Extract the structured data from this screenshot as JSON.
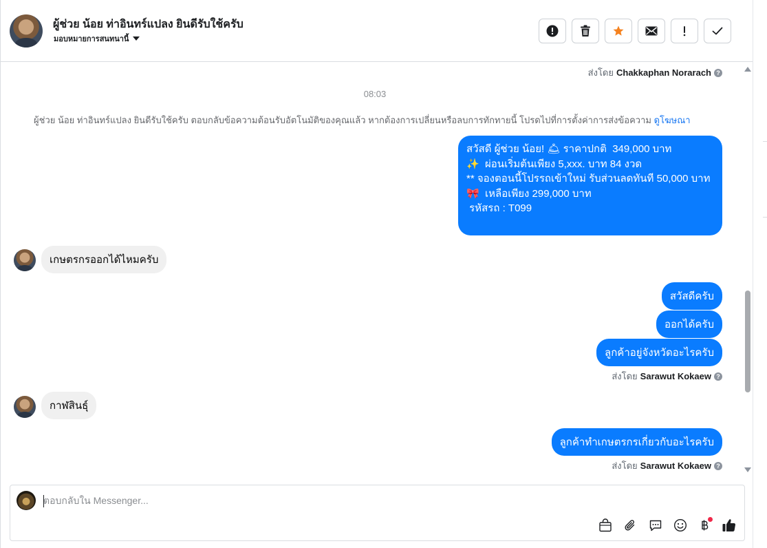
{
  "header": {
    "title": "ผู้ช่วย น้อย ท่าอินทร์แปลง ยินดีรับใช้ครับ",
    "subtitle": "มอบหมายการสนทนานี้",
    "actions": [
      "report-icon",
      "trash-icon",
      "star-icon",
      "mail-icon",
      "important-icon",
      "check-icon"
    ],
    "star_color": "#f5821f"
  },
  "messages": {
    "sent_by_prefix": "ส่งโดย",
    "sent_by_top": "Chakkaphan Norarach",
    "time": "08:03",
    "notice_text": "ผู้ช่วย น้อย ท่าอินทร์แปลง ยินดีรับใช้ครับ ตอบกลับข้อความต้อนรับอัตโนมัติของคุณแล้ว หากต้องการเปลี่ยนหรือลบการทักทายนี้ โปรดไปที่การตั้งค่าการส่งข้อความ",
    "notice_link": "ดูโฆษณา",
    "promo_lines": [
      "สวัสดี ผู้ช่วย น้อย! 🛎 ราคาปกติ  349,000 บาท",
      "✨  ผ่อนเริ่มต้นเพียง 5,xxx. บาท 84 งวด",
      "** จองตอนนี้โปรรถเข้าใหม่ รับส่วนลดทันที 50,000 บาท",
      "🎀  เหลือเพียง 299,000 บาท",
      "",
      " รหัสรถ : T099"
    ],
    "incoming_1": "เกษตรกรออกได้ไหมครับ",
    "out_1": "สวัสดีครับ",
    "out_2": "ออกได้ครับ",
    "out_3": "ลูกค้าอยู่จังหวัดอะไรครับ",
    "sent_by_2": "Sarawut Kokaew",
    "incoming_2": "กาฬสินธุ์",
    "out_4": "ลูกค้าทำเกษตรกรเกี่ยวกับอะไรครับ",
    "sent_by_3": "Sarawut Kokaew",
    "bubble_color": "#0a7cff"
  },
  "composer": {
    "placeholder": "ตอบกลับใน Messenger...",
    "tools": [
      "bag-icon",
      "attachment-icon",
      "saved-reply-icon",
      "emoji-icon",
      "baht-payment-icon",
      "thumbs-up-icon"
    ]
  }
}
